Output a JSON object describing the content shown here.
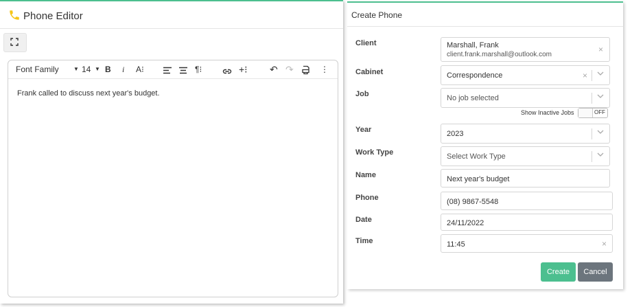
{
  "editor": {
    "title": "Phone Editor",
    "font_family": "Font Family",
    "font_size": "14",
    "body_text": "Frank called to discuss next year's budget."
  },
  "form": {
    "title": "Create Phone",
    "labels": {
      "client": "Client",
      "cabinet": "Cabinet",
      "job": "Job",
      "year": "Year",
      "work_type": "Work Type",
      "name": "Name",
      "phone": "Phone",
      "date": "Date",
      "time": "Time"
    },
    "client": {
      "name": "Marshall, Frank",
      "email": "client.frank.marshall@outlook.com"
    },
    "cabinet": "Correspondence",
    "job_placeholder": "No job selected",
    "show_inactive_jobs": "Show Inactive Jobs",
    "toggle_state": "OFF",
    "year": "2023",
    "work_type_placeholder": "Select Work Type",
    "name": "Next year's budget",
    "phone": "(08) 9867-5548",
    "date": "24/11/2022",
    "time": "11:45",
    "create_label": "Create",
    "cancel_label": "Cancel"
  },
  "colors": {
    "accent": "#4cbf8f",
    "cancel": "#6c757d",
    "phone_icon": "#f5c518"
  }
}
